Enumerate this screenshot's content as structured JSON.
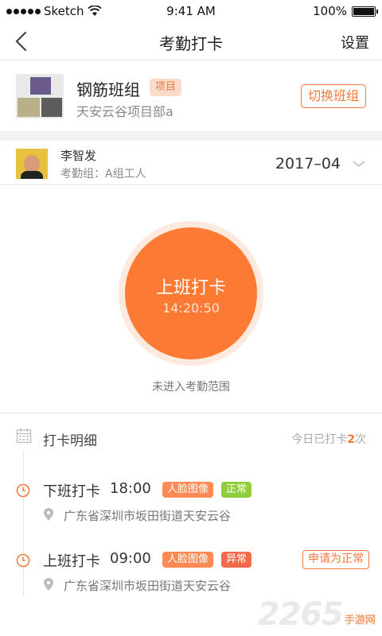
{
  "status_bar": {
    "carrier": "Sketch",
    "time": "9:41 AM",
    "battery": "100%",
    "battery_level": 1.0
  },
  "nav": {
    "title": "考勤打卡",
    "right_label": "设置",
    "back_icon": "chevron-left-icon"
  },
  "team": {
    "name": "钢筋班组",
    "tag": "项目",
    "project": "天安云谷项目部a",
    "switch_label": "切换班组"
  },
  "member": {
    "name": "李智发",
    "group": "考勤组：A组工人",
    "month": "2017–04"
  },
  "clock": {
    "label": "上班打卡",
    "time": "14:20:50",
    "range_text": "未进入考勤范围"
  },
  "detail": {
    "title": "打卡明细",
    "count_prefix": "今日已打卡",
    "count": "2",
    "count_suffix": "次"
  },
  "records": [
    {
      "type": "下班打卡",
      "time": "18:00",
      "face_tag": "人脸图像",
      "status": "正常",
      "status_color": "#8fcd3b",
      "location": "广东省深圳市坂田街道天安云谷"
    },
    {
      "type": "上班打卡",
      "time": "09:00",
      "face_tag": "人脸图像",
      "status": "异常",
      "status_color": "#f26a4b",
      "location": "广东省深圳市坂田街道天安云谷",
      "action": "申请为正常"
    }
  ],
  "watermark": {
    "number": "2265",
    "text": "手游网"
  },
  "colors": {
    "accent": "#fd7a35",
    "tag_bg": "#fbdccb"
  }
}
